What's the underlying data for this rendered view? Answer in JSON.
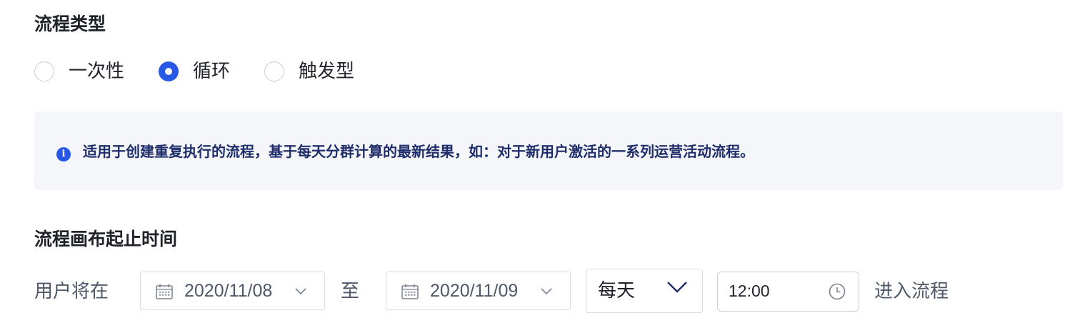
{
  "flow_type": {
    "title": "流程类型",
    "options": [
      {
        "label": "一次性",
        "checked": false
      },
      {
        "label": "循环",
        "checked": true
      },
      {
        "label": "触发型",
        "checked": false
      }
    ],
    "info": {
      "icon": "info-icon",
      "icon_glyph": "i",
      "text": "适用于创建重复执行的流程，基于每天分群计算的最新结果，如：对于新用户激活的一系列运营活动流程。"
    }
  },
  "canvas_time": {
    "title": "流程画布起止时间",
    "prefix": "用户将在",
    "start_date": "2020/11/08",
    "separator": "至",
    "end_date": "2020/11/09",
    "frequency": "每天",
    "time": "12:00",
    "suffix": "进入流程"
  },
  "colors": {
    "accent": "#2858e6",
    "info_bg": "#f4f6fa",
    "info_text": "#1f2d6b",
    "border": "#d9dde3"
  }
}
